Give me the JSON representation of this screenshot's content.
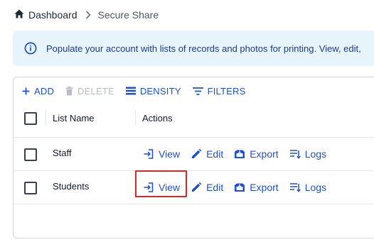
{
  "breadcrumb": {
    "home_label": "Dashboard",
    "current_label": "Secure Share"
  },
  "alert": {
    "message": "Populate your account with lists of records and photos for printing. View, edit,"
  },
  "toolbar": {
    "add_label": "ADD",
    "delete_label": "DELETE",
    "density_label": "DENSITY",
    "filters_label": "FILTERS"
  },
  "table": {
    "columns": [
      "List Name",
      "Actions"
    ],
    "rows": [
      {
        "name": "Staff",
        "actions": [
          "View",
          "Edit",
          "Export",
          "Logs"
        ]
      },
      {
        "name": "Students",
        "actions": [
          "View",
          "Edit",
          "Export",
          "Logs"
        ]
      }
    ]
  },
  "colors": {
    "accent": "#1d4ed8",
    "alert_bg": "#e8f4fc",
    "highlight": "#dc2626"
  }
}
